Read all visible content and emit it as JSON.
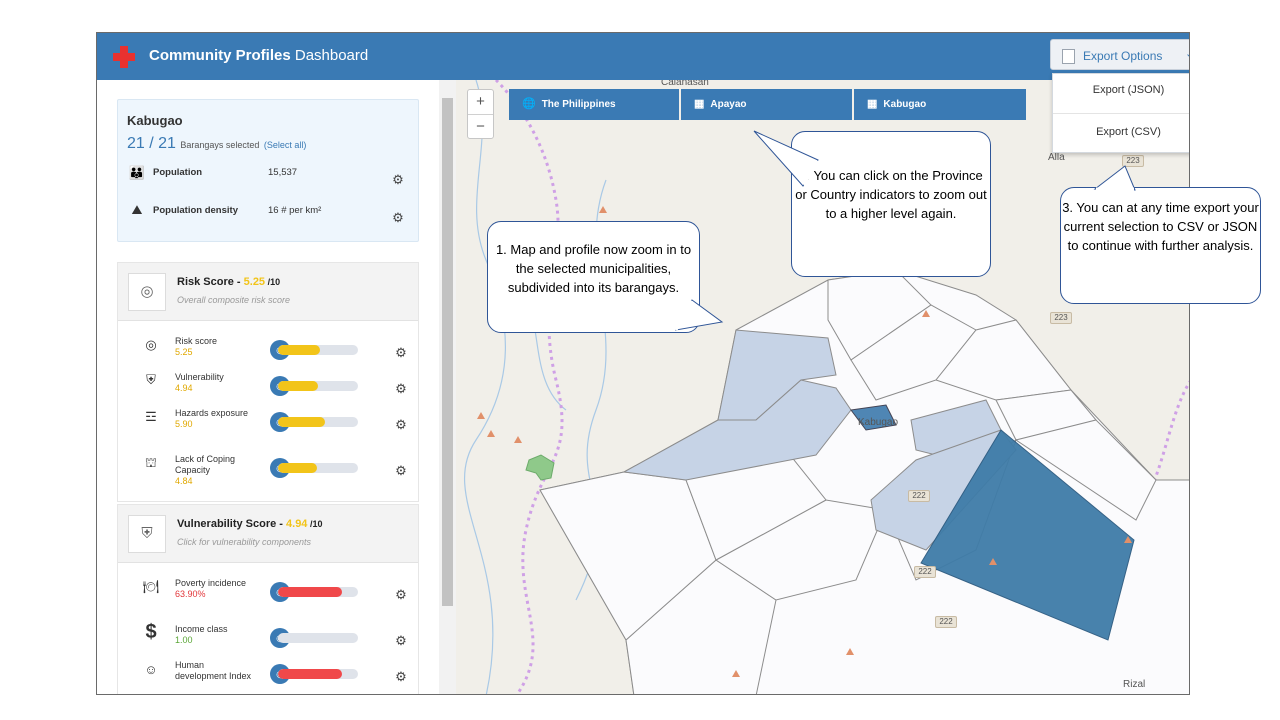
{
  "app": {
    "title_bold": "Community Profiles",
    "title_light": " Dashboard",
    "export": {
      "label": "Export Options",
      "menu": [
        "Export (JSON)",
        "Export (CSV)"
      ]
    }
  },
  "profile": {
    "name": "Kabugao",
    "selected": "21",
    "total": "21",
    "selected_label": "Barangays selected",
    "select_all": "(Select all)",
    "stats": [
      {
        "label": "Population",
        "value": "15,537",
        "icon": "people-icon"
      },
      {
        "label": "Population density",
        "value": "16 # per km²",
        "icon": "density-icon"
      }
    ]
  },
  "risk": {
    "title": "Risk Score - ",
    "score": "5.25",
    "denominator": " /10",
    "subtitle": "Overall composite risk score",
    "rows": [
      {
        "label": "Risk score",
        "value": "5.25",
        "fill": 0.525,
        "color": "#f2c419",
        "value_color": "#e0a800"
      },
      {
        "label": "Vulnerability",
        "value": "4.94",
        "fill": 0.494,
        "color": "#f2c419",
        "value_color": "#e0a800"
      },
      {
        "label": "Hazards exposure",
        "value": "5.90",
        "fill": 0.59,
        "color": "#f2c419",
        "value_color": "#e0a800"
      },
      {
        "label": "Lack of Coping Capacity",
        "value": "4.84",
        "fill": 0.484,
        "color": "#f2c419",
        "value_color": "#e0a800"
      }
    ]
  },
  "vulnerability": {
    "title": "Vulnerability Score - ",
    "score": "4.94",
    "denominator": " /10",
    "subtitle": "Click for vulnerability components",
    "rows": [
      {
        "label": "Poverty incidence",
        "value": "63.90%",
        "fill": 0.8,
        "color": "#f0484a",
        "value_color": "#e2363a"
      },
      {
        "label": "Income class",
        "value": "1.00",
        "fill": 0.0,
        "color": "#6cb33f",
        "value_color": "#5aa636"
      },
      {
        "label": "Human development Index",
        "value": "",
        "fill": 0.8,
        "color": "#f0484a",
        "value_color": "#e2363a"
      }
    ]
  },
  "map": {
    "breadcrumbs": [
      "The Philippines",
      "Apayao",
      "Kabugao"
    ],
    "labels": [
      "Calanasan",
      "Kabugao",
      "Rizal",
      "Alla"
    ],
    "roads": [
      "223",
      "223",
      "222",
      "222",
      "222"
    ],
    "selected_color": "#3a7ab4",
    "highlight_color": "#c6d3e6"
  },
  "callouts": [
    "1. Map and profile now zoom in to the selected municipalities, subdivided into its barangays.",
    "2. You can click on the Province or Country indicators to zoom out to a higher level again.",
    "3. You can at any time export your current selection to CSV or JSON to continue with further analysis."
  ]
}
